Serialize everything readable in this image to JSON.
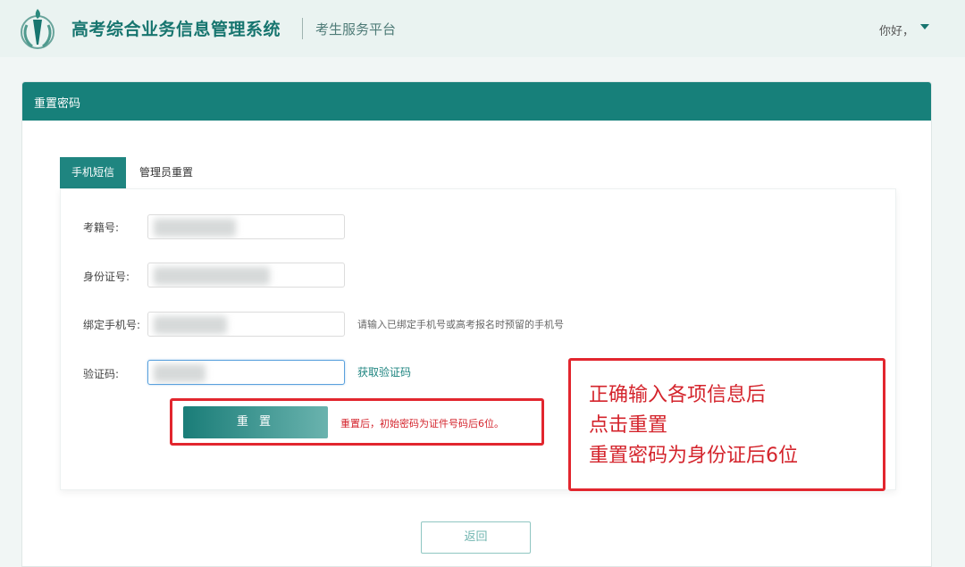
{
  "header": {
    "system_title": "高考综合业务信息管理系统",
    "sub_title": "考生服务平台",
    "greeting": "你好，"
  },
  "panel": {
    "title": "重置密码"
  },
  "tabs": [
    {
      "label": "手机短信",
      "active": true
    },
    {
      "label": "管理员重置",
      "active": false
    }
  ],
  "form": {
    "exam_no_label": "考籍号:",
    "id_no_label": "身份证号:",
    "phone_label": "绑定手机号:",
    "phone_hint": "请输入已绑定手机号或高考报名时预留的手机号",
    "code_label": "验证码:",
    "get_code_label": "获取验证码",
    "reset_label": "重 置",
    "reset_note": "重置后，初始密码为证件号码后6位。"
  },
  "annotation": {
    "lines": [
      "正确输入各项信息后",
      "点击重置",
      "重置密码为身份证后6位"
    ]
  },
  "footer": {
    "back_label": "返回"
  },
  "colors": {
    "accent": "#17807a",
    "annotation_red": "#e2262e"
  }
}
